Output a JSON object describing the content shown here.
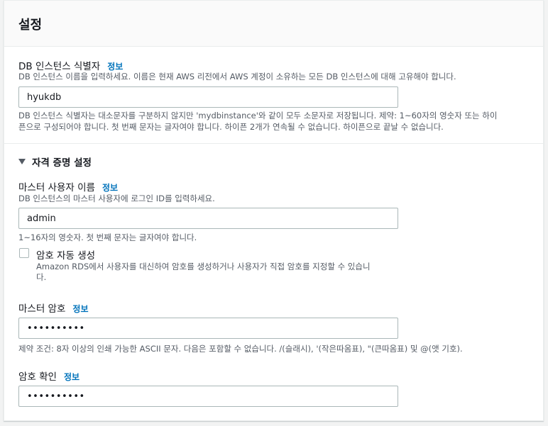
{
  "header": {
    "title": "설정"
  },
  "instance_id": {
    "label": "DB 인스턴스 식별자",
    "info": "정보",
    "description": "DB 인스턴스 이름을 입력하세요. 이름은 현재 AWS 리전에서 AWS 계정이 소유하는 모든 DB 인스턴스에 대해 고유해야 합니다.",
    "value": "hyukdb",
    "constraint_line1": "DB 인스턴스 식별자는 대소문자를 구분하지 않지만 'mydbinstance'와 같이 모두 소문자로 저장됩니다. 제약: 1~60자의 영숫자 또는 하이",
    "constraint_line2": "픈으로 구성되어야 합니다. 첫 번째 문자는 글자여야 합니다. 하이픈 2개가 연속될 수 없습니다. 하이픈으로 끝날 수 없습니다."
  },
  "credentials": {
    "section_label": "자격 증명 설정",
    "master_user": {
      "label": "마스터 사용자 이름",
      "info": "정보",
      "description": "DB 인스턴스의 마스터 사용자에 로그인 ID를 입력하세요.",
      "value": "admin",
      "constraint": "1~16자의 영숫자. 첫 번째 문자는 글자여야 합니다."
    },
    "auto_password": {
      "label": "암호 자동 생성",
      "checked": false,
      "description_line1": "Amazon RDS에서 사용자를 대신하여 암호를 생성하거나 사용자가 직접 암호를 지정할 수 있습니",
      "description_line2": "다."
    },
    "master_password": {
      "label": "마스터 암호",
      "info": "정보",
      "value": "••••••••••",
      "constraint": "제약 조건: 8자 이상의 인쇄 가능한 ASCII 문자. 다음은 포함할 수 없습니다. /(슬래시), '(작은따옴표), \"(큰따옴표) 및 @(앳 기호)."
    },
    "confirm_password": {
      "label": "암호 확인",
      "info": "정보",
      "value": "••••••••••"
    }
  }
}
